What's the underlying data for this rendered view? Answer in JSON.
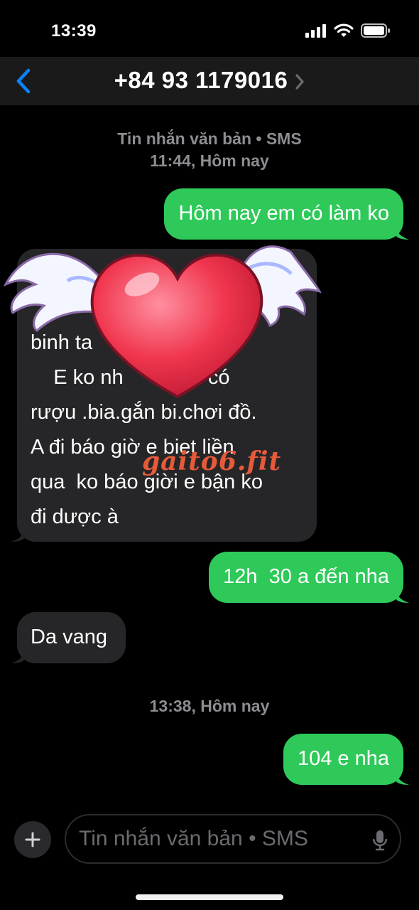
{
  "status_bar": {
    "time": "13:39"
  },
  "header": {
    "contact": "+84 93 1179016"
  },
  "conversation": {
    "meta_label": "Tin nhắn văn bản • SMS",
    "meta_time_1": "11:44, Hôm nay",
    "meta_time_2": "13:38, Hôm nay",
    "messages": [
      {
        "direction": "outgoing",
        "text": "Hôm nay em có làm ko"
      },
      {
        "direction": "incoming",
        "lines": [
          "",
          "",
          "binh ta",
          "    E ko nh          ch có",
          "rượu .bia.gắn bi.chơi đồ.",
          "A đi báo giờ e biet liền",
          "qua  ko báo giời e bận ko",
          "đi dược à"
        ]
      },
      {
        "direction": "outgoing",
        "text": "12h  30 a đến nha"
      },
      {
        "direction": "incoming",
        "text": "Da vang"
      },
      {
        "direction": "outgoing",
        "text": "104 e nha"
      }
    ]
  },
  "composer": {
    "placeholder": "Tin nhắn văn bản • SMS"
  },
  "overlay": {
    "watermark": "gaito6.fit",
    "sticker": "winged-heart"
  },
  "colors": {
    "outgoing": "#2fc95a",
    "incoming": "#262628",
    "accent": "#0a84ff",
    "background": "#000000"
  }
}
